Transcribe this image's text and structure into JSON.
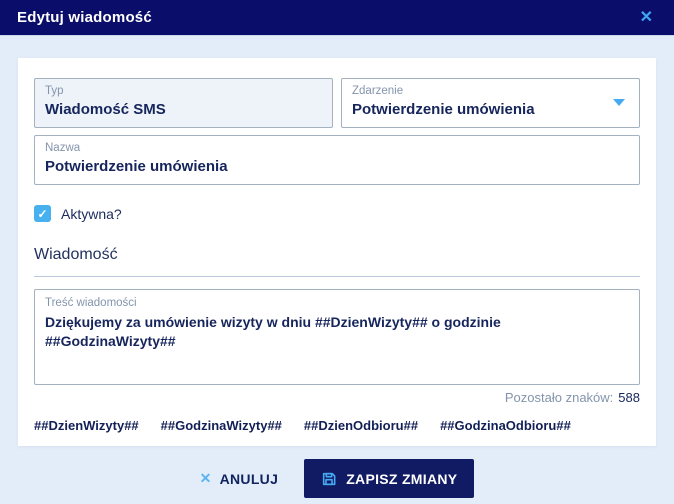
{
  "dialog": {
    "title": "Edytuj wiadomość",
    "close_glyph": "✕"
  },
  "form": {
    "typ": {
      "label": "Typ",
      "value": "Wiadomość SMS"
    },
    "zdarzenie": {
      "label": "Zdarzenie",
      "value": "Potwierdzenie umówienia"
    },
    "nazwa": {
      "label": "Nazwa",
      "value": "Potwierdzenie umówienia"
    },
    "aktywna": {
      "label": "Aktywna?",
      "checked": true,
      "check_glyph": "✓"
    },
    "section_heading": "Wiadomość",
    "tresc": {
      "label": "Treść wiadomości",
      "value": "Dziękujemy za umówienie wizyty w dniu ##DzienWizyty## o godzinie ##GodzinaWizyty##"
    },
    "remaining": {
      "label": "Pozostało znaków:",
      "value": "588"
    },
    "tags": [
      "##DzienWizyty##",
      "##GodzinaWizyty##",
      "##DzienOdbioru##",
      "##GodzinaOdbioru##"
    ]
  },
  "footer": {
    "cancel_glyph": "✕",
    "cancel_label": "ANULUJ",
    "save_label": "ZAPISZ ZMIANY"
  },
  "colors": {
    "header_bg": "#0b0d6a",
    "page_bg": "#e3edf9",
    "accent_blue": "#45aaf2",
    "text_navy": "#16255c",
    "label_grey": "#8494ac",
    "button_bg": "#111b63",
    "checkbox_blue": "#47b0ef"
  }
}
